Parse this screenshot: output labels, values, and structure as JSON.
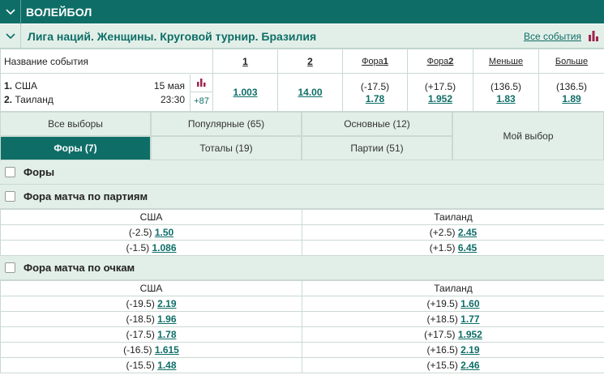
{
  "sport": {
    "title": "ВОЛЕЙБОЛ"
  },
  "league": {
    "title": "Лига наций. Женщины. Круговой турнир. Бразилия",
    "all_events": "Все события"
  },
  "table_header": {
    "name": "Название события",
    "col1": "1",
    "col2": "2",
    "fora1_a": "Фора",
    "fora1_b": "1",
    "fora2_a": "Фора",
    "fora2_b": "2",
    "less": "Меньше",
    "more": "Больше"
  },
  "event": {
    "team1_num": "1.",
    "team1": "США",
    "team2_num": "2.",
    "team2": "Таиланд",
    "date": "15 мая",
    "time": "23:30",
    "more_count": "+87",
    "odd1": "1.003",
    "odd2": "14.00",
    "fora1_param": "(-17.5)",
    "fora1_odd": "1.78",
    "fora2_param": "(+17.5)",
    "fora2_odd": "1.952",
    "less_param": "(136.5)",
    "less_odd": "1.83",
    "more_param": "(136.5)",
    "more_odd": "1.89"
  },
  "filters": {
    "all": "Все выборы",
    "popular": "Популярные (65)",
    "main": "Основные (12)",
    "foras": "Форы (7)",
    "totals": "Тоталы (19)",
    "sets": "Партии (51)",
    "mine": "Мой выбор"
  },
  "sections": {
    "foras": "Форы",
    "fora_sets": "Фора матча по партиям",
    "fora_points": "Фора матча по очкам"
  },
  "fora_sets": {
    "team1": "США",
    "team2": "Таиланд",
    "rows": [
      {
        "p1": "(-2.5)",
        "o1": "1.50",
        "p2": "(+2.5)",
        "o2": "2.45"
      },
      {
        "p1": "(-1.5)",
        "o1": "1.086",
        "p2": "(+1.5)",
        "o2": "6.45"
      }
    ]
  },
  "fora_points": {
    "team1": "США",
    "team2": "Таиланд",
    "rows": [
      {
        "p1": "(-19.5)",
        "o1": "2.19",
        "p2": "(+19.5)",
        "o2": "1.60"
      },
      {
        "p1": "(-18.5)",
        "o1": "1.96",
        "p2": "(+18.5)",
        "o2": "1.77"
      },
      {
        "p1": "(-17.5)",
        "o1": "1.78",
        "p2": "(+17.5)",
        "o2": "1.952"
      },
      {
        "p1": "(-16.5)",
        "o1": "1.615",
        "p2": "(+16.5)",
        "o2": "2.19"
      },
      {
        "p1": "(-15.5)",
        "o1": "1.48",
        "p2": "(+15.5)",
        "o2": "2.46"
      }
    ]
  },
  "colors": {
    "primary": "#0e6e67",
    "light": "#e2efe8",
    "stats": "#a0244f"
  }
}
